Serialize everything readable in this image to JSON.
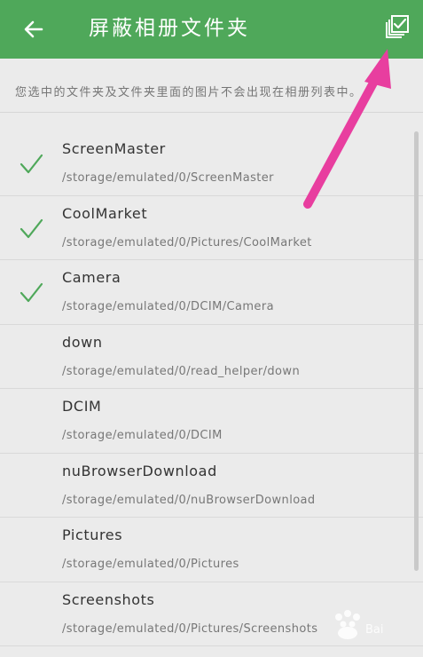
{
  "header": {
    "title": "屏蔽相册文件夹"
  },
  "hint": "您选中的文件夹及文件夹里面的图片不会出现在相册列表中。",
  "folders": [
    {
      "name": "ScreenMaster",
      "path": "/storage/emulated/0/ScreenMaster",
      "checked": true
    },
    {
      "name": "CoolMarket",
      "path": "/storage/emulated/0/Pictures/CoolMarket",
      "checked": true
    },
    {
      "name": "Camera",
      "path": "/storage/emulated/0/DCIM/Camera",
      "checked": true
    },
    {
      "name": "down",
      "path": "/storage/emulated/0/read_helper/down",
      "checked": false
    },
    {
      "name": "DCIM",
      "path": "/storage/emulated/0/DCIM",
      "checked": false
    },
    {
      "name": "nuBrowserDownload",
      "path": "/storage/emulated/0/nuBrowserDownload",
      "checked": false
    },
    {
      "name": "Pictures",
      "path": "/storage/emulated/0/Pictures",
      "checked": false
    },
    {
      "name": "Screenshots",
      "path": "/storage/emulated/0/Pictures/Screenshots",
      "checked": false
    }
  ],
  "colors": {
    "appbar": "#4fa85a",
    "check": "#4fa85a",
    "annotation_arrow": "#e83e9f"
  },
  "icons": {
    "back": "arrow-left-icon",
    "select_all": "select-all-icon",
    "check": "checkmark-icon"
  }
}
